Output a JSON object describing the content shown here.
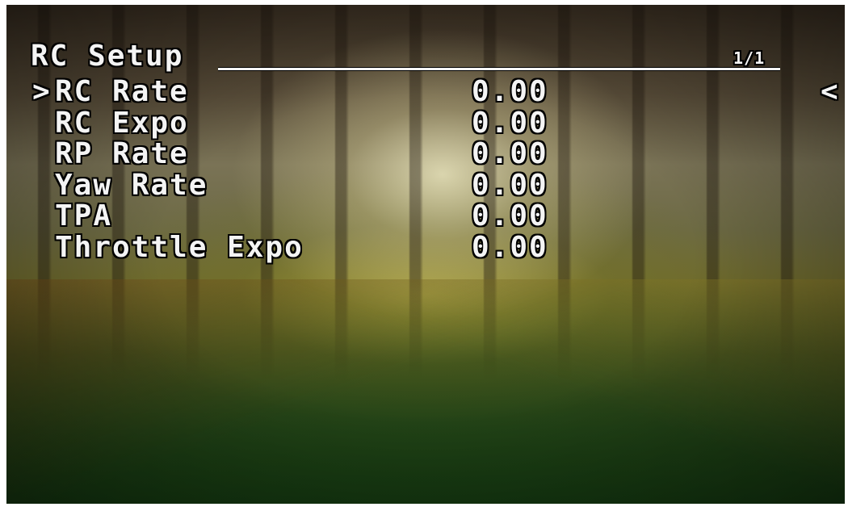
{
  "menu": {
    "title": "RC Setup",
    "page_indicator": "1/1",
    "cursor_glyph": ">",
    "back_glyph": "<",
    "items": [
      {
        "label": "RC Rate",
        "value": "0.00",
        "selected": true
      },
      {
        "label": "RC Expo",
        "value": "0.00",
        "selected": false
      },
      {
        "label": "RP Rate",
        "value": "0.00",
        "selected": false
      },
      {
        "label": "Yaw Rate",
        "value": "0.00",
        "selected": false
      },
      {
        "label": "TPA",
        "value": "0.00",
        "selected": false
      },
      {
        "label": "Throttle Expo",
        "value": "0.00",
        "selected": false
      }
    ]
  },
  "colors": {
    "osd_text": "#f4f4f4",
    "osd_outline": "#000000"
  }
}
